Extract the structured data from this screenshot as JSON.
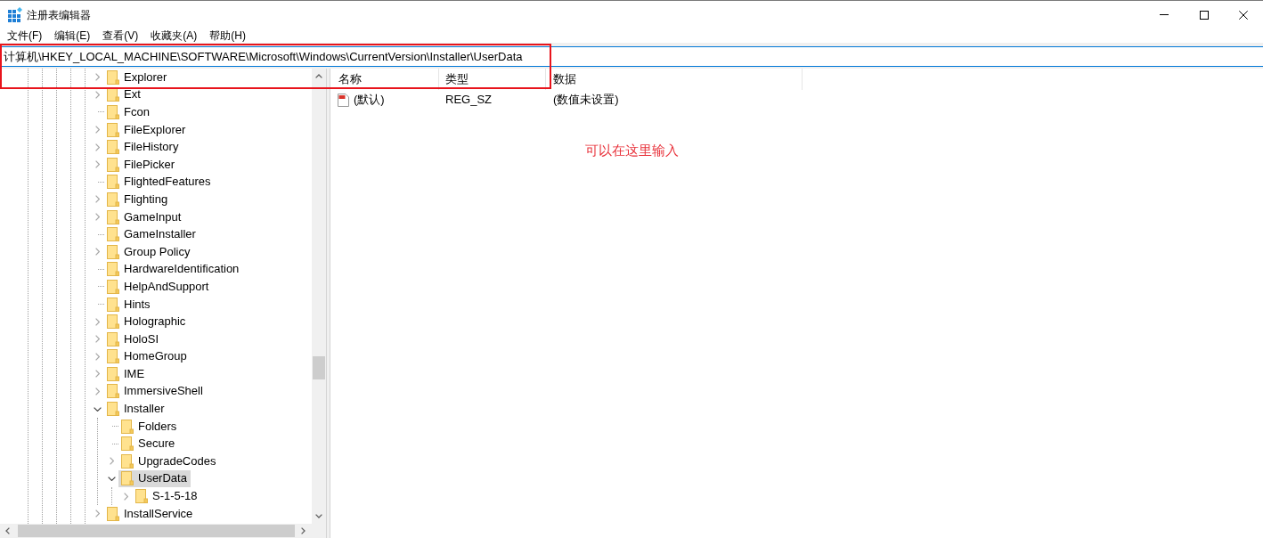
{
  "window": {
    "title": "注册表编辑器"
  },
  "menu": [
    "文件(F)",
    "编辑(E)",
    "查看(V)",
    "收藏夹(A)",
    "帮助(H)"
  ],
  "address_bar": {
    "value": "计算机\\HKEY_LOCAL_MACHINE\\SOFTWARE\\Microsoft\\Windows\\CurrentVersion\\Installer\\UserData"
  },
  "tree": {
    "items": [
      {
        "label": "Explorer",
        "expandable": true,
        "expanded": false,
        "selected": false
      },
      {
        "label": "Ext",
        "expandable": true,
        "expanded": false,
        "selected": false
      },
      {
        "label": "Fcon",
        "expandable": false,
        "expanded": false,
        "selected": false
      },
      {
        "label": "FileExplorer",
        "expandable": true,
        "expanded": false,
        "selected": false
      },
      {
        "label": "FileHistory",
        "expandable": true,
        "expanded": false,
        "selected": false
      },
      {
        "label": "FilePicker",
        "expandable": true,
        "expanded": false,
        "selected": false
      },
      {
        "label": "FlightedFeatures",
        "expandable": false,
        "expanded": false,
        "selected": false
      },
      {
        "label": "Flighting",
        "expandable": true,
        "expanded": false,
        "selected": false
      },
      {
        "label": "GameInput",
        "expandable": true,
        "expanded": false,
        "selected": false
      },
      {
        "label": "GameInstaller",
        "expandable": false,
        "expanded": false,
        "selected": false
      },
      {
        "label": "Group Policy",
        "expandable": true,
        "expanded": false,
        "selected": false
      },
      {
        "label": "HardwareIdentification",
        "expandable": false,
        "expanded": false,
        "selected": false
      },
      {
        "label": "HelpAndSupport",
        "expandable": false,
        "expanded": false,
        "selected": false
      },
      {
        "label": "Hints",
        "expandable": false,
        "expanded": false,
        "selected": false
      },
      {
        "label": "Holographic",
        "expandable": true,
        "expanded": false,
        "selected": false
      },
      {
        "label": "HoloSI",
        "expandable": true,
        "expanded": false,
        "selected": false
      },
      {
        "label": "HomeGroup",
        "expandable": true,
        "expanded": false,
        "selected": false
      },
      {
        "label": "IME",
        "expandable": true,
        "expanded": false,
        "selected": false
      },
      {
        "label": "ImmersiveShell",
        "expandable": true,
        "expanded": false,
        "selected": false
      },
      {
        "label": "Installer",
        "expandable": true,
        "expanded": true,
        "selected": false,
        "children": [
          {
            "label": "Folders",
            "expandable": false,
            "expanded": false,
            "selected": false
          },
          {
            "label": "Secure",
            "expandable": false,
            "expanded": false,
            "selected": false
          },
          {
            "label": "UpgradeCodes",
            "expandable": true,
            "expanded": false,
            "selected": false
          },
          {
            "label": "UserData",
            "expandable": true,
            "expanded": true,
            "selected": true,
            "children": [
              {
                "label": "S-1-5-18",
                "expandable": true,
                "expanded": false,
                "selected": false
              }
            ]
          }
        ]
      },
      {
        "label": "InstallService",
        "expandable": true,
        "expanded": false,
        "selected": false
      }
    ]
  },
  "value_list": {
    "columns": [
      "名称",
      "类型",
      "数据"
    ],
    "rows": [
      {
        "name": "(默认)",
        "type": "REG_SZ",
        "data": "(数值未设置)",
        "selected": false
      }
    ]
  },
  "annotation": {
    "text": "可以在这里输入"
  }
}
